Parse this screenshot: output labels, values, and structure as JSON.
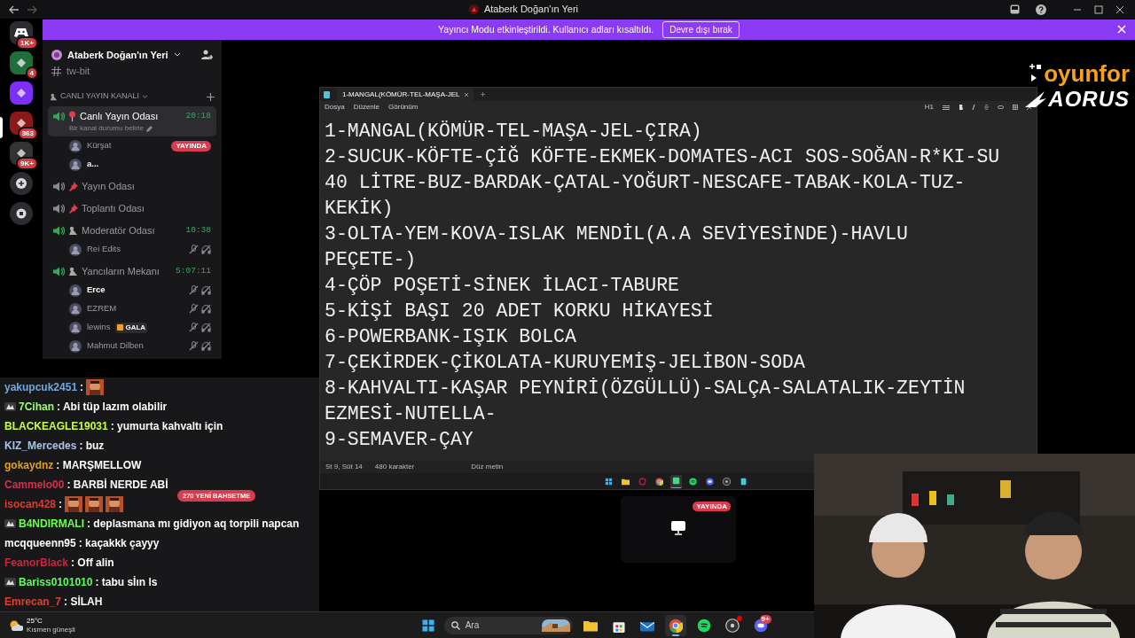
{
  "window": {
    "title": "Ataberk Doğan'ın Yeri"
  },
  "banner": {
    "text": "Yayıncı Modu etkinleştirildi. Kullanıcı adları kısaltıldı.",
    "button": "Devre dışı bırak"
  },
  "server_rail": [
    {
      "kind": "home",
      "badge": "1K+",
      "selected": false,
      "color": "#2b2d31"
    },
    {
      "kind": "server",
      "badge": "4",
      "selected": false,
      "color": "#1f6f3a"
    },
    {
      "kind": "server",
      "selected": false,
      "color": "#7b2ff7"
    },
    {
      "kind": "server",
      "badge": "363",
      "selected": true,
      "color": "#8a1a1a"
    },
    {
      "kind": "server",
      "badge": "9K+",
      "selected": false,
      "color": "#333333"
    },
    {
      "kind": "add",
      "selected": false
    },
    {
      "kind": "discover",
      "selected": false
    }
  ],
  "sidebar": {
    "server_name": "Ataberk Doğan'ın Yeri",
    "channels": [
      {
        "kind": "text",
        "name": "tw-bit"
      },
      {
        "kind": "category",
        "name": "CANLI YAYIN KANALI"
      },
      {
        "kind": "voice",
        "marker": {
          "kind": "pin"
        },
        "name": "Canlı Yayın Odası",
        "active": true,
        "selected": true,
        "timer": "20:18",
        "status": "Bir kanal durumu belirle",
        "users": [
          {
            "name": "Kürşat",
            "badge": "YAYINDA",
            "muted": false
          },
          {
            "name": "a...",
            "muted": false
          }
        ]
      },
      {
        "kind": "voice",
        "marker": {
          "kind": "pushpin"
        },
        "name": "Yayın Odası",
        "active": false,
        "selected": false
      },
      {
        "kind": "voice",
        "marker": {
          "kind": "pushpin"
        },
        "name": "Toplantı Odası",
        "active": false,
        "selected": false
      },
      {
        "kind": "voice",
        "marker": {
          "kind": "figure"
        },
        "name": "Moderatör Odası",
        "active": true,
        "selected": false,
        "timer": "10:38",
        "users": [
          {
            "name": "Rei Edits",
            "muted": true
          }
        ]
      },
      {
        "kind": "voice",
        "marker": {
          "kind": "figure"
        },
        "name": "Yancıların Mekanı",
        "active": true,
        "selected": false,
        "timer": "5:07:11",
        "users": [
          {
            "name": "Erce",
            "muted": true
          },
          {
            "name": "EZREM",
            "muted": true
          },
          {
            "name": "lewins",
            "tag": "GALA",
            "muted": true
          },
          {
            "name": "Mahmut Dilben",
            "muted": true
          }
        ]
      }
    ]
  },
  "chat": [
    {
      "user": "yakupcuk2451",
      "color": "#6fa8dc",
      "text": ":",
      "badge": false
    },
    {
      "user": "7Cihan",
      "color": "#9cff6a",
      "text": ": Abi tüp lazım olabilir",
      "badge": true
    },
    {
      "user": "BLACKEAGLE19031",
      "color": "#c6ff3a",
      "text": ": yumurta kahvaltı için",
      "badge": false
    },
    {
      "user": "KIZ_Mercedes",
      "color": "#a9c4e8",
      "text": ": buz",
      "badge": false
    },
    {
      "user": "gokaydnz",
      "color": "#e0a020",
      "text": ": MARŞMELLOW",
      "badge": false
    },
    {
      "user": "Cammelo00",
      "color": "#d6304a",
      "text": ": BARBİ NERDE ABİ",
      "badge": false
    },
    {
      "user": "isocan428",
      "color": "#e03a2a",
      "text": ":",
      "badge": false
    },
    {
      "user": "B4NDIRMALI",
      "color": "#6aff4a",
      "text": ": deplasmana mı gidiyon aq torpili napcan",
      "badge": true
    },
    {
      "user": "mcqqueenn95",
      "color": "#ffffff",
      "text": ": kaçakkk çayyy",
      "badge": false
    },
    {
      "user": "FeanorBlack",
      "color": "#c8283a",
      "text": ": Off alin",
      "badge": false
    },
    {
      "user": "Bariss0101010",
      "color": "#5aff5a",
      "text": ": tabu sİın ls",
      "badge": true
    },
    {
      "user": "Emrecan_7",
      "color": "#e0402a",
      "text": ": SİLAH",
      "badge": false
    }
  ],
  "mention_badge": "270 YENİ BAHSETME",
  "editor": {
    "tab": "1-MANGAL(KÖMÜR-TEL-MAŞA-JEL",
    "menus": [
      "Dosya",
      "Düzenle",
      "Görünüm"
    ],
    "heading": "H1",
    "lines": [
      "1-MANGAL(KÖMÜR-TEL-MAŞA-JEL-ÇIRA)",
      "2-SUCUK-KÖFTE-ÇİĞ KÖFTE-EKMEK-DOMATES-ACI SOS-SOĞAN-R*KI-SU",
      "40 LİTRE-BUZ-BARDAK-ÇATAL-YOĞURT-NESCAFE-TABAK-KOLA-TUZ-",
      "KEKİK)",
      "3-OLTA-YEM-KOVA-ISLAK MENDİL(A.A SEVİYESİNDE)-HAVLU",
      "PEÇETE-)",
      "4-ÇÖP POŞETİ-SİNEK İLACI-TABURE",
      "5-KİŞİ BAŞI 20 ADET KORKU HİKAYESİ",
      "6-POWERBANK-IŞIK BOLCA",
      "7-ÇEKİRDEK-ÇİKOLATA-KURUYEMİŞ-JELİBON-SODA",
      "8-KAHVALTI-KAŞAR PEYNİRİ(ÖZGÜLLÜ)-SALÇA-SALATALIK-ZEYTİN",
      "EZMESİ-NUTELLA-",
      "9-SEMAVER-ÇAY"
    ],
    "status": [
      "St 9, Süt 14",
      "480 karakter",
      "Düz metin"
    ]
  },
  "inner_taskbar": [
    {
      "kind": "windows",
      "active": false
    },
    {
      "kind": "folder",
      "active": false
    },
    {
      "kind": "ring",
      "active": false
    },
    {
      "kind": "chrome",
      "active": false
    },
    {
      "kind": "square",
      "active": true
    },
    {
      "kind": "spotify",
      "active": false
    },
    {
      "kind": "discord",
      "active": false
    },
    {
      "kind": "obs",
      "active": false
    },
    {
      "kind": "notepad",
      "active": false
    }
  ],
  "live_card": {
    "badge": "YAYINDA"
  },
  "logos": {
    "top": "oyunfor",
    "bottom": "AORUS"
  },
  "taskbar": {
    "temperature": "25°C",
    "weather": "Kısmen güneşli",
    "search": "Ara",
    "apps": [
      {
        "kind": "folder",
        "active": false
      },
      {
        "kind": "store",
        "active": false
      },
      {
        "kind": "mail",
        "active": false
      },
      {
        "kind": "chrome",
        "active": true
      },
      {
        "kind": "spotify",
        "active": false
      },
      {
        "kind": "obs",
        "active": false,
        "dot": true
      },
      {
        "kind": "discord",
        "active": false,
        "badge": "9+"
      }
    ]
  }
}
